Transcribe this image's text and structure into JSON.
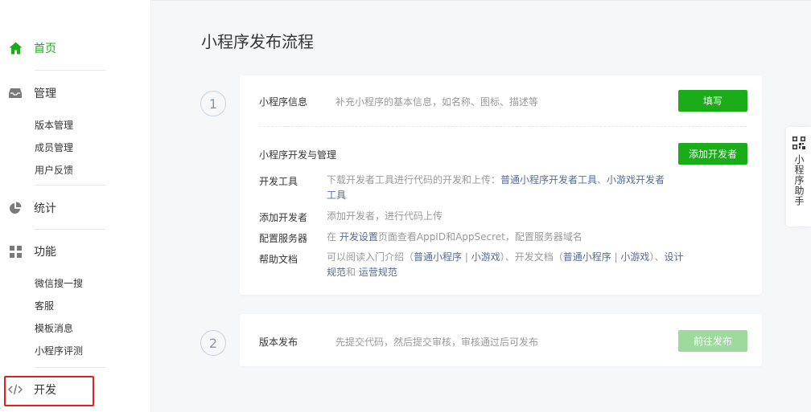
{
  "sidebar": {
    "home": "首页",
    "manage": "管理",
    "manage_items": [
      "版本管理",
      "成员管理",
      "用户反馈"
    ],
    "stats": "统计",
    "features": "功能",
    "feature_items": [
      "微信搜一搜",
      "客服",
      "模板消息",
      "小程序评测"
    ],
    "dev": "开发"
  },
  "colors": {
    "accent": "#1aad19",
    "link": "#576b95",
    "highlight": "#e02020"
  },
  "main": {
    "title": "小程序发布流程",
    "step1_num": "1",
    "step2_num": "2",
    "card1": {
      "info_label": "小程序信息",
      "info_desc": "补充小程序的基本信息，如名称、图标、描述等",
      "fill_button": "填写",
      "dev_label": "小程序开发与管理",
      "add_dev_button": "添加开发者",
      "rows": [
        {
          "key": "开发工具",
          "pre": "下载开发者工具进行代码的开发和上传：",
          "link1": "普通小程序开发者工具",
          "mid": "、",
          "link2": "小游戏开发者工具"
        },
        {
          "key": "添加开发者",
          "text": "添加开发者，进行代码上传"
        },
        {
          "key": "配置服务器",
          "pre": "在 ",
          "link1": "开发设置",
          "post": "页面查看AppID和AppSecret，配置服务器域名"
        },
        {
          "key": "帮助文档",
          "pre": "可以阅读入门介绍（",
          "link1": "普通小程序",
          "sep1": " | ",
          "link2": "小游戏",
          "mid": "）、开发文档（",
          "link3": "普通小程序",
          "sep2": " | ",
          "link4": "小游戏",
          "mid2": "）、",
          "link5": "设计规范",
          "and": "和 ",
          "link6": "运营规范"
        }
      ]
    },
    "card2": {
      "label": "版本发布",
      "desc": "先提交代码，然后提交审核，审核通过后可发布",
      "button": "前往发布"
    }
  },
  "assistant": {
    "label": "小程序助手"
  }
}
